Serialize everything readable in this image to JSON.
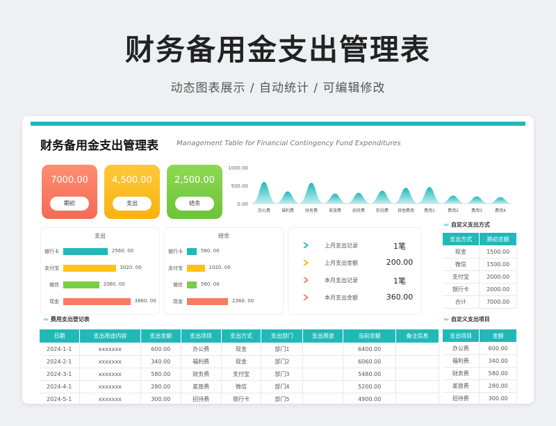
{
  "hero": {
    "title": "财务备用金支出管理表",
    "subtitle": "动态图表展示  /  自动统计  /  可编辑修改"
  },
  "sheet": {
    "title": "财务备用金支出管理表",
    "subtitle": "Management Table for Financial Contingency Fund Expenditures"
  },
  "cards": [
    {
      "value": "7000.00",
      "button": "期初",
      "color": "#f46a55"
    },
    {
      "value": "4,500.00",
      "button": "支出",
      "color": "#f8b20e"
    },
    {
      "value": "2,500.00",
      "button": "结余",
      "color": "#6cc43a"
    }
  ],
  "chart_data": [
    {
      "type": "area",
      "categories": [
        "办公费",
        "福利费",
        "财务费",
        "差旅费",
        "招待费",
        "折旧费",
        "其他费用",
        "费用1",
        "费用2",
        "费用3",
        "费用4"
      ],
      "values": [
        600,
        340,
        580,
        280,
        300,
        360,
        440,
        460,
        220,
        200,
        180
      ],
      "ylim": [
        0,
        1000
      ],
      "yticks": [
        "1000.00",
        "500.00",
        "0.00"
      ],
      "color": "#22b8b8"
    },
    {
      "type": "bar",
      "title": "支出",
      "categories": [
        "银行卡",
        "支付宝",
        "微信",
        "现金"
      ],
      "values": [
        2560,
        3020,
        2060,
        3860
      ],
      "labels": [
        "2560. 00",
        "3020. 00",
        "2060. 00",
        "3860. 00"
      ],
      "colors": [
        "#22b8b8",
        "#ffc21a",
        "#7ccd45",
        "#f47c62"
      ]
    },
    {
      "type": "bar",
      "title": "结余",
      "categories": [
        "银行卡",
        "支付宝",
        "微信",
        "现金"
      ],
      "values": [
        560,
        1020,
        560,
        2360
      ],
      "labels": [
        "560. 00",
        "1020. 00",
        "560. 00",
        "2360. 00"
      ],
      "colors": [
        "#22b8b8",
        "#ffc21a",
        "#7ccd45",
        "#f47c62"
      ]
    }
  ],
  "stats": [
    {
      "label": "上月支出记录",
      "value": "1笔",
      "color": "#22b8b8"
    },
    {
      "label": "上月支出金额",
      "value": "200.00",
      "color": "#f8b20e"
    },
    {
      "label": "本月支出记录",
      "value": "1笔",
      "color": "#f47c62"
    },
    {
      "label": "本月支出金额",
      "value": "360.00",
      "color": "#f47c62"
    }
  ],
  "sections": {
    "ledger": "费用支出登记表",
    "methods": "自定义支出方式",
    "items": "自定义支出项目"
  },
  "ledger": {
    "headers": [
      "日期",
      "支出用途内容",
      "支出金额",
      "支出项目",
      "支出方式",
      "支出部门",
      "支出用途",
      "当前余额",
      "备注信息"
    ],
    "rows": [
      [
        "2024-1-1",
        "xxxxxxx",
        "600.00",
        "办公费",
        "现金",
        "部门1",
        "",
        "6400.00",
        ""
      ],
      [
        "2024-2-1",
        "xxxxxxx",
        "340.00",
        "福利费",
        "现金",
        "部门2",
        "",
        "6060.00",
        ""
      ],
      [
        "2024-3-1",
        "xxxxxxx",
        "580.00",
        "财务费",
        "支付宝",
        "部门3",
        "",
        "5480.00",
        ""
      ],
      [
        "2024-4-1",
        "xxxxxxx",
        "280.00",
        "差旅费",
        "微信",
        "部门4",
        "",
        "5200.00",
        ""
      ],
      [
        "2024-5-1",
        "xxxxxxx",
        "300.00",
        "招待费",
        "银行卡",
        "部门5",
        "",
        "4900.00",
        ""
      ]
    ]
  },
  "methods": {
    "headers": [
      "支出方式",
      "期初余额"
    ],
    "rows": [
      [
        "现金",
        "1500.00"
      ],
      [
        "微信",
        "1500.00"
      ],
      [
        "支付宝",
        "2000.00"
      ],
      [
        "银行卡",
        "2000.00"
      ],
      [
        "合计",
        "7000.00"
      ]
    ]
  },
  "items": {
    "headers": [
      "支出项目",
      "金额"
    ],
    "rows": [
      [
        "办公费",
        "600.00"
      ],
      [
        "福利费",
        "340.00"
      ],
      [
        "财务费",
        "580.00"
      ],
      [
        "差旅费",
        "280.00"
      ],
      [
        "招待费",
        "300.00"
      ]
    ]
  }
}
